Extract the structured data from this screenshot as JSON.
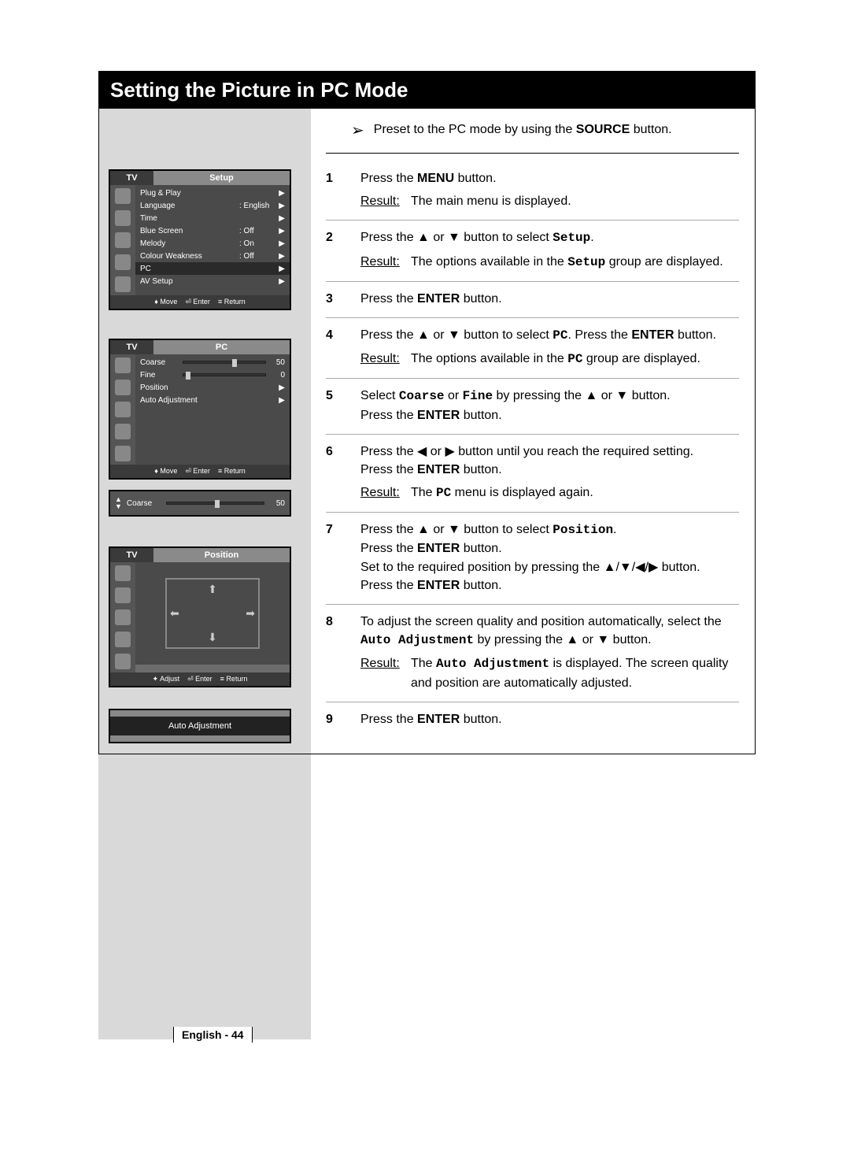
{
  "page": {
    "title": "Setting the Picture in PC Mode",
    "preset": {
      "pre": "Preset to the PC mode by using the ",
      "bold": "SOURCE",
      "post": " button."
    },
    "footer": "English - 44"
  },
  "steps": [
    {
      "num": "1",
      "lines": [
        {
          "t": "Press the ",
          "b": "MENU",
          "a": " button."
        }
      ],
      "result": "The main menu is displayed."
    },
    {
      "num": "2",
      "lines": [
        {
          "t": "Press the ▲ or ▼ button to select ",
          "m": "Setup",
          "a": "."
        }
      ],
      "result_html": {
        "pre": "The options available in the ",
        "mono": "Setup",
        "post": " group are displayed."
      }
    },
    {
      "num": "3",
      "lines": [
        {
          "t": "Press the ",
          "b": "ENTER",
          "a": " button."
        }
      ]
    },
    {
      "num": "4",
      "lines": [
        {
          "t": "Press the ▲ or ▼ button to select ",
          "m": "PC",
          "a": ". Press the ",
          "b2": "ENTER",
          "a2": " button."
        }
      ],
      "result_html": {
        "pre": "The options available in the ",
        "mono": "PC",
        "post": " group are displayed."
      }
    },
    {
      "num": "5",
      "lines": [
        {
          "t": "Select ",
          "m": "Coarse",
          "mid": " or ",
          "m2": "Fine",
          "a": " by pressing the ▲ or ▼ button."
        },
        {
          "t": "Press the ",
          "b": "ENTER",
          "a": " button."
        }
      ]
    },
    {
      "num": "6",
      "lines": [
        {
          "t": "Press the ◀ or ▶ button until you reach the required setting."
        },
        {
          "t": "Press the ",
          "b": "ENTER",
          "a": " button."
        }
      ],
      "result_html": {
        "pre": "The ",
        "mono": "PC",
        "post": " menu is displayed again."
      }
    },
    {
      "num": "7",
      "lines": [
        {
          "t": "Press the ▲ or ▼ button to select ",
          "m": "Position",
          "a": "."
        },
        {
          "t": "Press the ",
          "b": "ENTER",
          "a": " button."
        },
        {
          "t": "Set to the required position by pressing the ▲/▼/◀/▶ button."
        },
        {
          "t": "Press the ",
          "b": "ENTER",
          "a": " button."
        }
      ]
    },
    {
      "num": "8",
      "lines": [
        {
          "t": "To adjust the screen quality and position automatically, select the"
        },
        {
          "m": "Auto Adjustment",
          "a": " by pressing the ▲ or ▼ button."
        }
      ],
      "result_html": {
        "pre": "The ",
        "mono": "Auto Adjustment",
        "post": " is displayed. The screen quality and position are automatically adjusted."
      }
    },
    {
      "num": "9",
      "lines": [
        {
          "t": "Press the ",
          "b": "ENTER",
          "a": " button."
        }
      ]
    }
  ],
  "osd_setup": {
    "tv": "TV",
    "title": "Setup",
    "rows": [
      {
        "label": "Plug & Play",
        "val": "",
        "arrow": "▶"
      },
      {
        "label": "Language",
        "val": ": English",
        "arrow": "▶"
      },
      {
        "label": "Time",
        "val": "",
        "arrow": "▶"
      },
      {
        "label": "Blue Screen",
        "val": ": Off",
        "arrow": "▶"
      },
      {
        "label": "Melody",
        "val": ": On",
        "arrow": "▶"
      },
      {
        "label": "Colour Weakness",
        "val": ": Off",
        "arrow": "▶"
      },
      {
        "label": "PC",
        "val": "",
        "arrow": "▶",
        "sel": true
      },
      {
        "label": "AV Setup",
        "val": "",
        "arrow": "▶"
      }
    ],
    "footer": {
      "move": "Move",
      "enter": "Enter",
      "return": "Return"
    }
  },
  "osd_pc": {
    "tv": "TV",
    "title": "PC",
    "coarse": {
      "label": "Coarse",
      "val": "50",
      "pos": 60
    },
    "fine": {
      "label": "Fine",
      "val": "0",
      "pos": 3
    },
    "rows": [
      {
        "label": "Position",
        "arrow": "▶"
      },
      {
        "label": "Auto Adjustment",
        "arrow": "▶"
      }
    ],
    "footer": {
      "move": "Move",
      "enter": "Enter",
      "return": "Return"
    }
  },
  "osd_coarse": {
    "label": "Coarse",
    "val": "50",
    "pos": 50
  },
  "osd_position": {
    "tv": "TV",
    "title": "Position",
    "footer": {
      "adjust": "Adjust",
      "enter": "Enter",
      "return": "Return"
    }
  },
  "osd_auto": {
    "label": "Auto Adjustment"
  },
  "labels": {
    "result": "Result:"
  }
}
